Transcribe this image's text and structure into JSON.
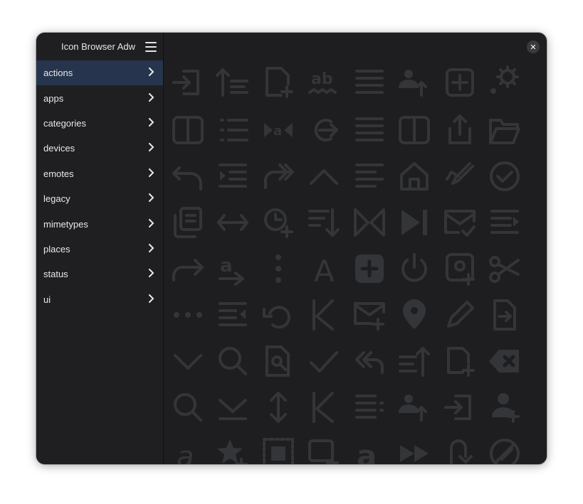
{
  "app": {
    "title": "Icon Browser Adw"
  },
  "sidebar": {
    "items": [
      {
        "label": "actions",
        "active": true
      },
      {
        "label": "apps"
      },
      {
        "label": "categories"
      },
      {
        "label": "devices"
      },
      {
        "label": "emotes"
      },
      {
        "label": "legacy"
      },
      {
        "label": "mimetypes"
      },
      {
        "label": "places"
      },
      {
        "label": "status"
      },
      {
        "label": "ui"
      }
    ]
  },
  "colors": {
    "accent": "#26354d",
    "icon": "#343538",
    "background": "#1e1e20"
  },
  "icon_grid": {
    "rows": [
      [
        "log-in-icon",
        "sort-ascending-icon",
        "document-new-icon",
        "spellcheck-icon",
        "align-justify-icon",
        "contact-transfer-icon",
        "list-add-icon",
        "settings-icon"
      ],
      [
        "view-dual-icon",
        "view-list-icon",
        "media-seek-icon",
        "go-next-icon",
        "align-justify-icon",
        "view-split-icon",
        "share-icon",
        "folder-open-icon"
      ],
      [
        "undo-icon",
        "indent-more-icon",
        "redo-icon",
        "go-up-icon",
        "align-left-icon",
        "go-home-icon",
        "edit-redo-icon",
        "checkmark-circle-icon"
      ],
      [
        "copy-icon",
        "arrows-horizontal-icon",
        "alarm-add-icon",
        "sort-descending-icon",
        "view-mirror-icon",
        "media-skip-forward-icon",
        "mail-read-icon",
        "format-text-icon"
      ],
      [
        "forward-icon",
        "text-direction-icon",
        "more-vertical-icon",
        "font-icon",
        "add-square-icon",
        "power-icon",
        "mail-add-icon",
        "cut-icon"
      ],
      [
        "more-horizontal-icon",
        "indent-less-icon",
        "rotate-left-icon",
        "key-icon",
        "mail-send-icon",
        "location-icon",
        "edit-icon",
        "document-send-icon"
      ],
      [
        "chevron-down-icon",
        "zoom-icon",
        "document-search-icon",
        "check-icon",
        "reply-all-icon",
        "sort-up-icon",
        "tab-new-icon",
        "clear-icon"
      ],
      [
        "search-icon",
        "go-bottom-icon",
        "move-vertical-icon",
        "key-icon",
        "list-icon",
        "contact-transfer-icon",
        "log-in-icon",
        "contact-add-icon"
      ],
      [
        "italic-icon",
        "star-add-icon",
        "selection-icon",
        "window-new-icon",
        "bold-icon",
        "seek-forward-icon",
        "go-jump-icon",
        "edit-clear-icon"
      ]
    ]
  }
}
